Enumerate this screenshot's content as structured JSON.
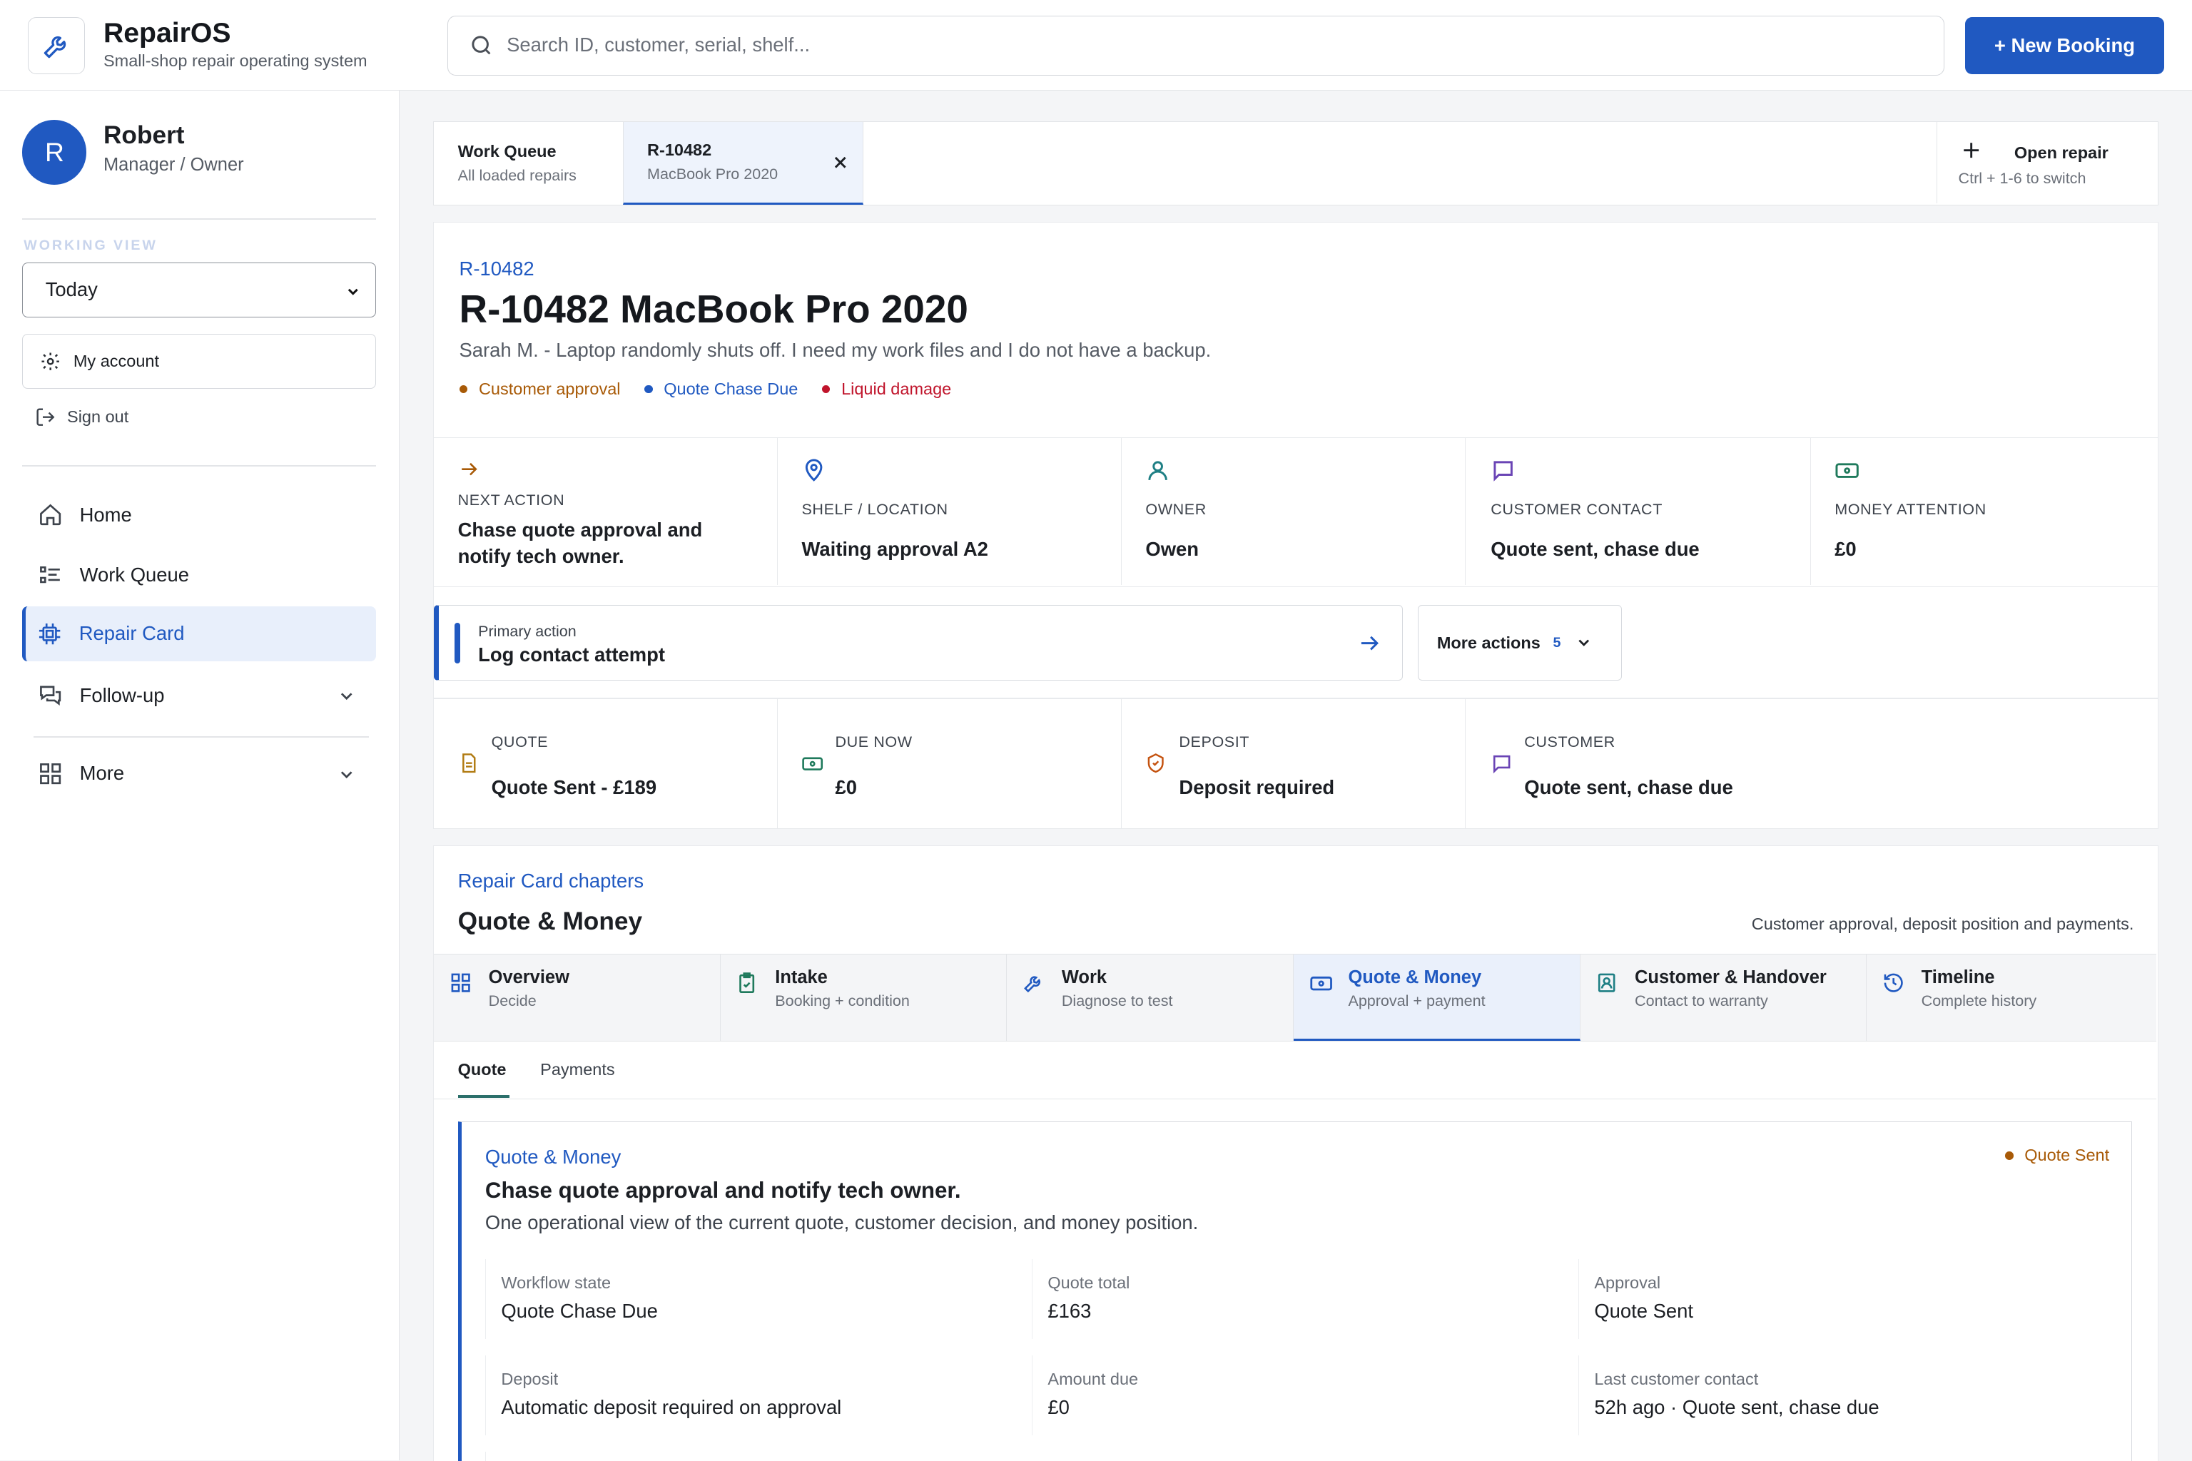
{
  "app": {
    "name": "RepairOS",
    "tagline": "Small-shop repair operating system"
  },
  "search": {
    "placeholder": "Search ID, customer, serial, shelf..."
  },
  "new_booking": "+ New Booking",
  "user": {
    "initial": "R",
    "name": "Robert",
    "role": "Manager / Owner"
  },
  "working_view": {
    "label": "WORKING VIEW",
    "value": "Today"
  },
  "my_account": "My account",
  "sign_out": "Sign out",
  "nav": [
    {
      "label": "Home"
    },
    {
      "label": "Work Queue"
    },
    {
      "label": "Repair Card"
    },
    {
      "label": "Follow-up"
    },
    {
      "label": "More"
    }
  ],
  "tabs": [
    {
      "title": "Work Queue",
      "sub": "All loaded repairs"
    },
    {
      "title": "R-10482",
      "sub": "MacBook Pro 2020"
    }
  ],
  "open_repair": {
    "title": "Open repair",
    "hint": "Ctrl + 1-6 to switch"
  },
  "repair": {
    "id": "R-10482",
    "title": "R-10482 MacBook Pro 2020",
    "description": "Sarah M. - Laptop randomly shuts off. I need my work files and I do not have a backup.",
    "tags": [
      {
        "label": "Customer approval",
        "color": "#a85a07"
      },
      {
        "label": "Quote Chase Due",
        "color": "#2059c1"
      },
      {
        "label": "Liquid damage",
        "color": "#c0142b"
      }
    ]
  },
  "stats": [
    {
      "label": "NEXT ACTION",
      "value": "Chase quote approval and notify tech owner."
    },
    {
      "label": "SHELF / LOCATION",
      "value": "Waiting approval A2"
    },
    {
      "label": "OWNER",
      "value": "Owen"
    },
    {
      "label": "CUSTOMER CONTACT",
      "value": "Quote sent, chase due"
    },
    {
      "label": "MONEY ATTENTION",
      "value": "£0"
    }
  ],
  "primary_action": {
    "label": "Primary action",
    "value": "Log contact attempt"
  },
  "more_actions": {
    "label": "More actions",
    "count": "5"
  },
  "money": [
    {
      "label": "QUOTE",
      "value": "Quote Sent - £189"
    },
    {
      "label": "DUE NOW",
      "value": "£0"
    },
    {
      "label": "DEPOSIT",
      "value": "Deposit required"
    },
    {
      "label": "CUSTOMER",
      "value": "Quote sent, chase due"
    }
  ],
  "chapters": {
    "kicker": "Repair Card chapters",
    "title": "Quote & Money",
    "subtitle": "Customer approval, deposit position and payments.",
    "tabs": [
      {
        "title": "Overview",
        "sub": "Decide"
      },
      {
        "title": "Intake",
        "sub": "Booking + condition"
      },
      {
        "title": "Work",
        "sub": "Diagnose to test"
      },
      {
        "title": "Quote & Money",
        "sub": "Approval + payment"
      },
      {
        "title": "Customer & Handover",
        "sub": "Contact to warranty"
      },
      {
        "title": "Timeline",
        "sub": "Complete history"
      }
    ],
    "sub_tabs": [
      "Quote",
      "Payments"
    ]
  },
  "quote_panel": {
    "kicker": "Quote & Money",
    "title": "Chase quote approval and notify tech owner.",
    "desc": "One operational view of the current quote, customer decision, and money position.",
    "badge": "Quote Sent",
    "fields": [
      {
        "k": "Workflow state",
        "v": "Quote Chase Due"
      },
      {
        "k": "Quote total",
        "v": "£163"
      },
      {
        "k": "Approval",
        "v": "Quote Sent"
      },
      {
        "k": "Deposit",
        "v": "Automatic deposit required on approval"
      },
      {
        "k": "Amount due",
        "v": "£0"
      },
      {
        "k": "Last customer contact",
        "v": "52h ago · Quote sent, chase due"
      }
    ]
  },
  "colors": {
    "accent": "#2059c1",
    "warning": "#a85a07",
    "danger": "#c0142b",
    "success": "#1f7a5c"
  }
}
